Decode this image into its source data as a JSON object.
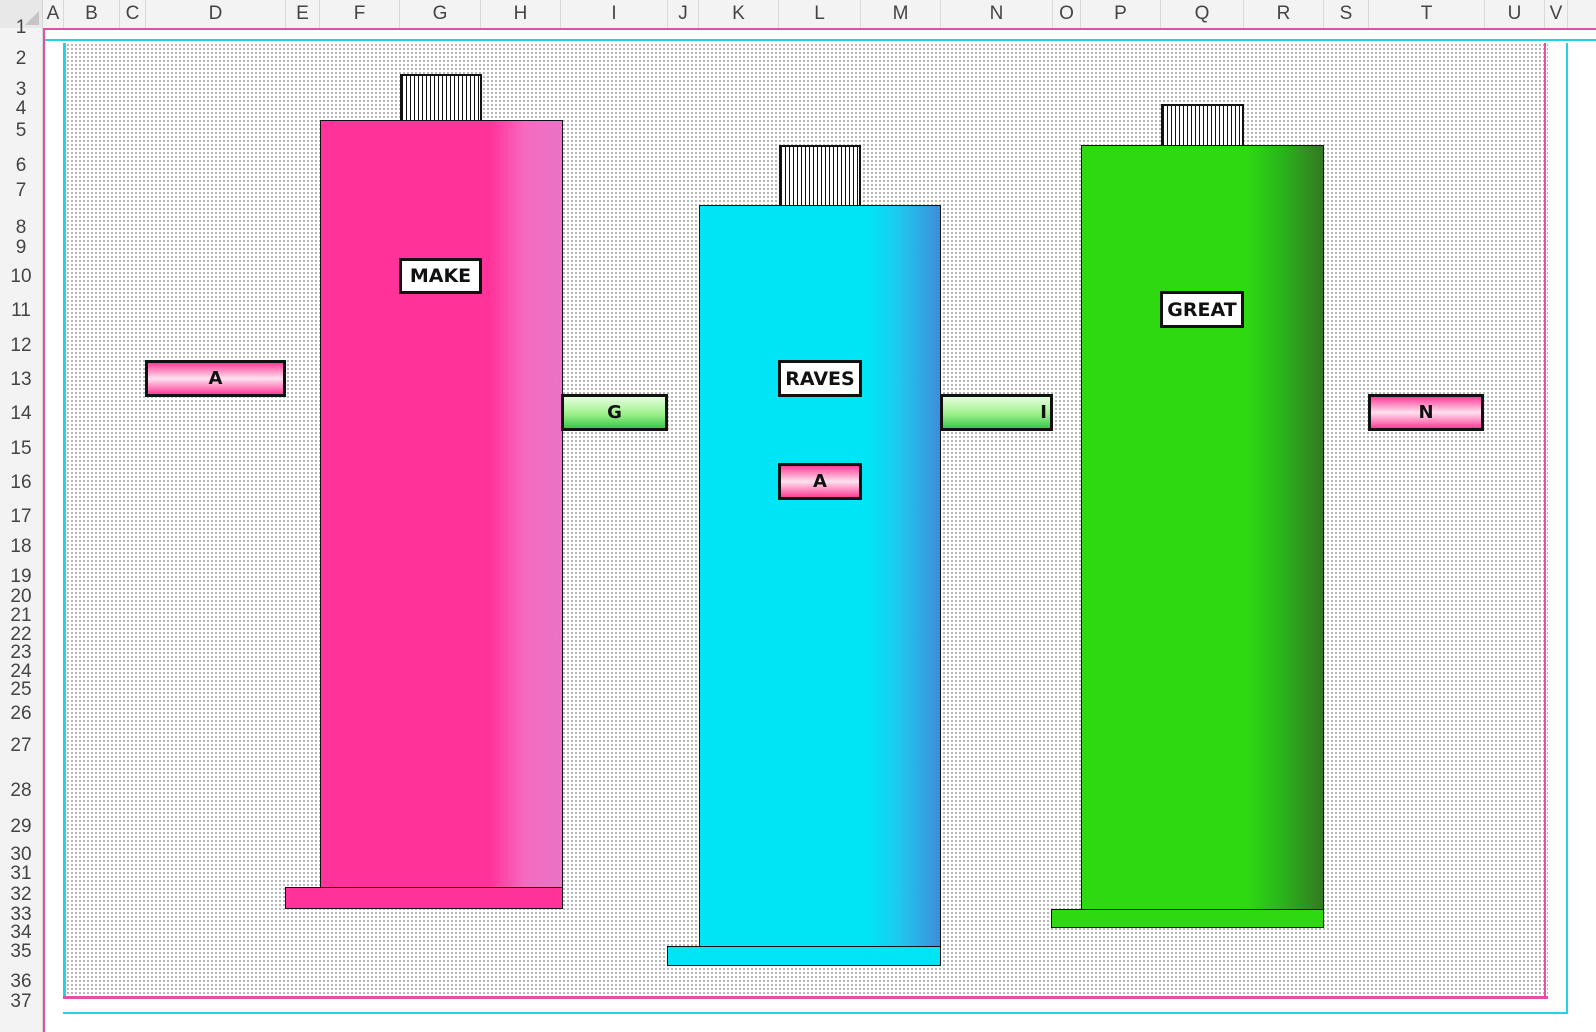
{
  "columns": [
    "A",
    "B",
    "C",
    "D",
    "E",
    "F",
    "G",
    "H",
    "I",
    "J",
    "K",
    "L",
    "M",
    "N",
    "O",
    "P",
    "Q",
    "R",
    "S",
    "T",
    "U",
    "V"
  ],
  "rows": [
    "1",
    "2",
    "3",
    "4",
    "5",
    "6",
    "7",
    "8",
    "9",
    "10",
    "11",
    "12",
    "13",
    "14",
    "15",
    "16",
    "17",
    "18",
    "19",
    "20",
    "21",
    "22",
    "23",
    "24",
    "25",
    "26",
    "27",
    "28",
    "29",
    "30",
    "31",
    "32",
    "33",
    "34",
    "35",
    "36",
    "37"
  ],
  "tubes": {
    "pink": {
      "label": "MAKE"
    },
    "cyan": {
      "label": "RAVES",
      "tag": "A"
    },
    "green": {
      "label": "GREAT"
    }
  },
  "tags": {
    "left_a": "A",
    "g": "G",
    "i": "I",
    "n": "N"
  },
  "colors": {
    "pink": "#ff3399",
    "cyan": "#00e5f5",
    "green": "#2fd912",
    "frame_cyan": "#22d3e6",
    "frame_pink": "#e64fa8"
  }
}
